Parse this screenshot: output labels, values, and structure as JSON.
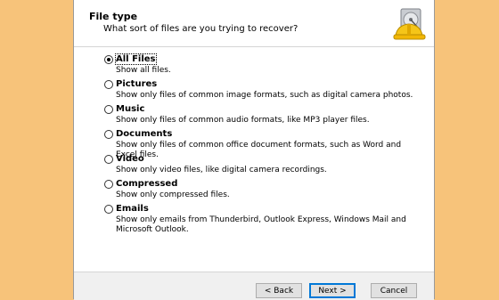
{
  "header": {
    "title": "File type",
    "subtitle": "What sort of files are you trying to recover?",
    "icon": "recovery-hdd-hardhat-icon"
  },
  "options": [
    {
      "label": "All Files",
      "description": "Show all files.",
      "selected": true
    },
    {
      "label": "Pictures",
      "description": "Show only files of common image formats, such as digital camera photos.",
      "selected": false
    },
    {
      "label": "Music",
      "description": "Show only files of common audio formats, like MP3 player files.",
      "selected": false
    },
    {
      "label": "Documents",
      "description": "Show only files of common office document formats, such as Word and Excel files.",
      "selected": false
    },
    {
      "label": "Video",
      "description": "Show only video files, like digital camera recordings.",
      "selected": false
    },
    {
      "label": "Compressed",
      "description": "Show only compressed files.",
      "selected": false
    },
    {
      "label": "Emails",
      "description": "Show only emails from Thunderbird, Outlook Express, Windows Mail and Microsoft Outlook.",
      "selected": false
    }
  ],
  "footer": {
    "back_label": "< Back",
    "next_label": "Next >",
    "cancel_label": "Cancel"
  },
  "colors": {
    "background": "#f7c37a",
    "primary_border": "#0078d7"
  }
}
